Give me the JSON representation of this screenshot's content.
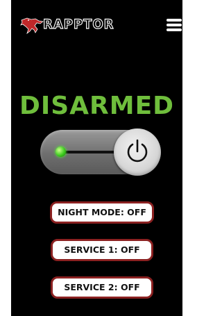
{
  "app": {
    "logo_text": "RAPPTOR"
  },
  "status": {
    "label": "DISARMED",
    "color": "#6fbe3c"
  },
  "arm_toggle": {
    "state": "off",
    "indicator_color": "#3dcc1f",
    "icon": "power-icon"
  },
  "modes": [
    {
      "label": "NIGHT MODE: OFF"
    },
    {
      "label": "SERVICE 1: OFF"
    },
    {
      "label": "SERVICE 2: OFF"
    }
  ],
  "menu": {
    "icon": "hamburger-menu-icon"
  },
  "colors": {
    "background": "#000000",
    "button_border": "#8b2121",
    "button_fill": "#ffffff"
  }
}
